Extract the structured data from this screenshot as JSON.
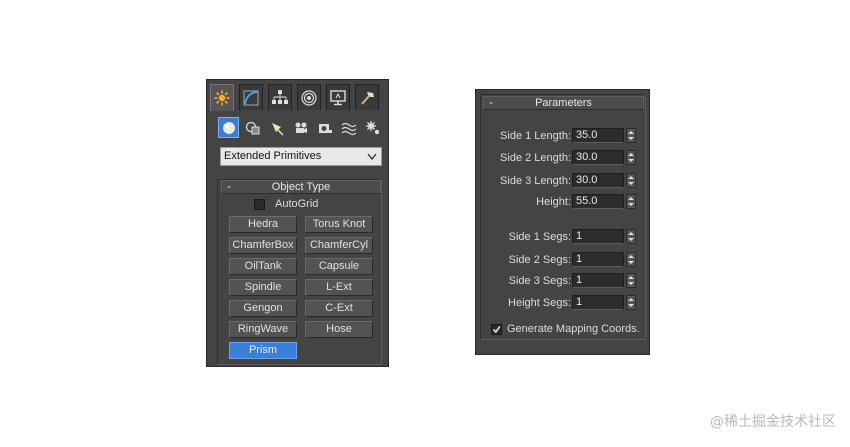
{
  "command_panel": {
    "tabs": [
      {
        "name": "create",
        "icon": "sun-star-icon",
        "active": true
      },
      {
        "name": "modify",
        "icon": "curve-modify-icon"
      },
      {
        "name": "hierarchy",
        "icon": "hierarchy-icon"
      },
      {
        "name": "motion",
        "icon": "motion-icon"
      },
      {
        "name": "display",
        "icon": "display-monitor-icon"
      },
      {
        "name": "utilities",
        "icon": "hammer-icon"
      }
    ],
    "subcategories": [
      {
        "name": "geometry",
        "icon": "sphere-icon",
        "active": true
      },
      {
        "name": "shapes",
        "icon": "shapes-icon"
      },
      {
        "name": "lights",
        "icon": "light-icon"
      },
      {
        "name": "cameras",
        "icon": "camera-icon"
      },
      {
        "name": "helpers",
        "icon": "helper-tape-icon"
      },
      {
        "name": "space-warps",
        "icon": "waves-icon"
      },
      {
        "name": "systems",
        "icon": "gears-icon"
      }
    ],
    "category_dropdown": "Extended Primitives",
    "object_type": {
      "title": "Object Type",
      "collapse_symbol": "-",
      "autogrid_label": "AutoGrid",
      "autogrid_checked": false,
      "buttons": [
        [
          "Hedra",
          "Torus Knot"
        ],
        [
          "ChamferBox",
          "ChamferCyl"
        ],
        [
          "OilTank",
          "Capsule"
        ],
        [
          "Spindle",
          "L-Ext"
        ],
        [
          "Gengon",
          "C-Ext"
        ],
        [
          "RingWave",
          "Hose"
        ],
        [
          "Prism"
        ]
      ],
      "selected": "Prism"
    }
  },
  "parameters": {
    "title": "Parameters",
    "collapse_symbol": "-",
    "fields": [
      {
        "label": "Side 1 Length:",
        "value": "35.0"
      },
      {
        "label": "Side 2 Length:",
        "value": "30.0"
      },
      {
        "label": "Side 3 Length:",
        "value": "30.0"
      },
      {
        "label": "Height:",
        "value": "55.0"
      },
      {
        "label": "Side 1 Segs:",
        "value": "1"
      },
      {
        "label": "Side 2 Segs:",
        "value": "1"
      },
      {
        "label": "Side 3 Segs:",
        "value": "1"
      },
      {
        "label": "Height Segs:",
        "value": "1"
      }
    ],
    "generate_mapping_label": "Generate Mapping Coords.",
    "generate_mapping_checked": true
  },
  "watermark": "@稀土掘金技术社区",
  "colors": {
    "panel_bg": "#444444",
    "selected_blue": "#3b7fd8",
    "field_bg": "#2c2c2c"
  }
}
